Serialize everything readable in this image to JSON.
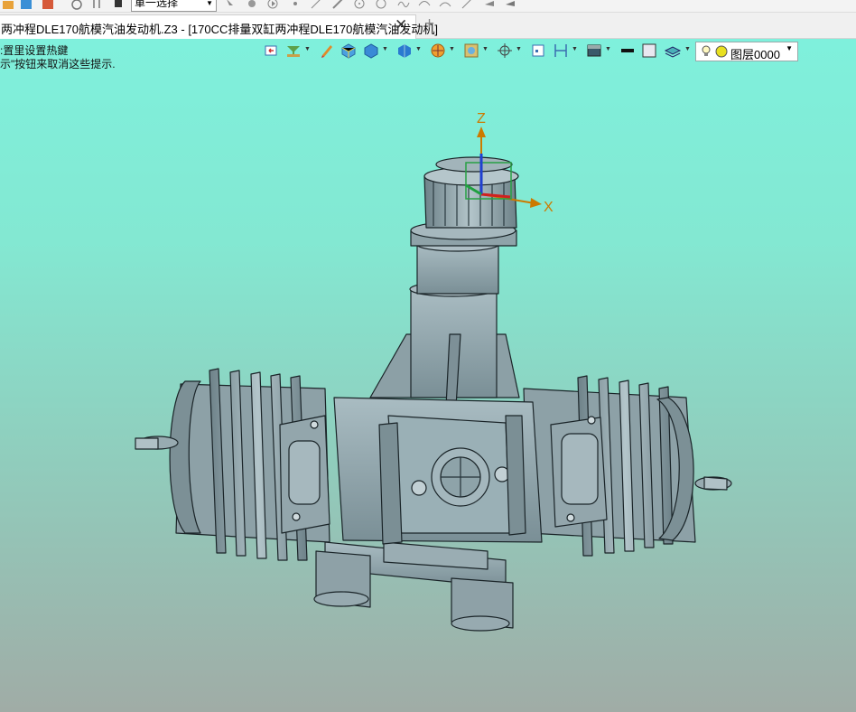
{
  "toolbar": {
    "selection_mode": "單一选择"
  },
  "tabs": {
    "active_title": "两冲程DLE170航模汽油发动机.Z3 - [170CC排量双缸两冲程DLE170航模汽油发动机]",
    "close_symbol": "✕",
    "new_tab_symbol": "+"
  },
  "viewport": {
    "hint_line_1": ":置里设置热鍵",
    "hint_line_2": "示\"按钮来取消这些提示."
  },
  "axes": {
    "z_label": "Z",
    "x_label": "X"
  },
  "layer": {
    "name": "图层0000"
  },
  "colors": {
    "viewport_top": "#7ff0dc",
    "viewport_bottom": "#a0aca6",
    "model_fill": "#8fa3a8",
    "model_edge": "#1a2428",
    "axis_color": "#cc7a00"
  }
}
